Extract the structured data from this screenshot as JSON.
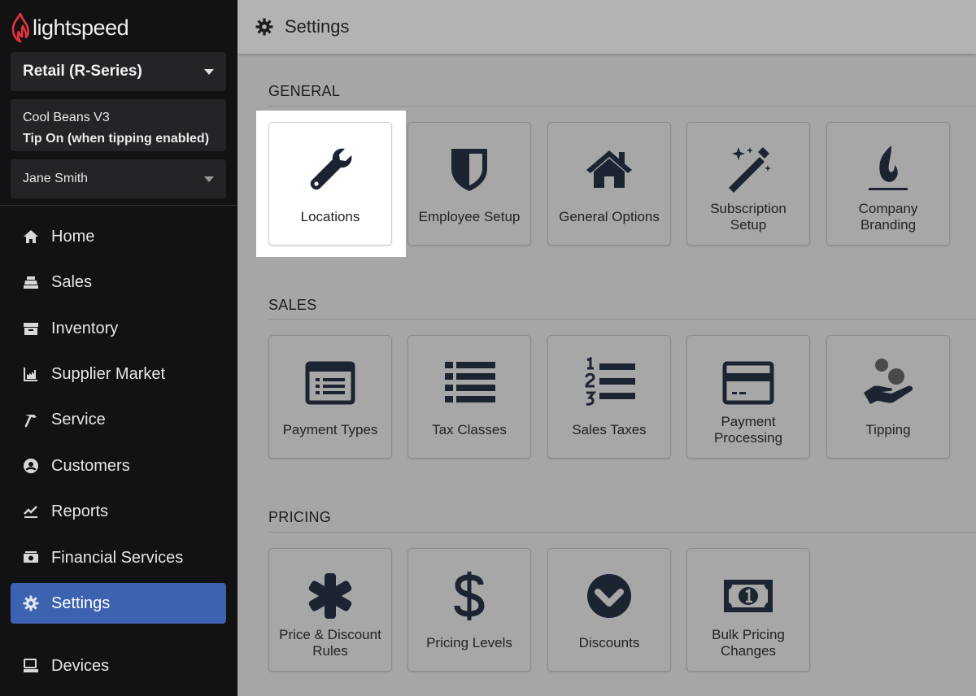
{
  "brand": {
    "name": "lightspeed",
    "logo_icon": "flame-icon",
    "accent": "#e4343f"
  },
  "sidebar": {
    "product": "Retail (R-Series)",
    "location_name": "Cool Beans V3",
    "location_sub": "Tip On (when tipping enabled)",
    "user": "Jane Smith",
    "items": [
      {
        "label": "Home",
        "icon": "home-icon"
      },
      {
        "label": "Sales",
        "icon": "register-icon"
      },
      {
        "label": "Inventory",
        "icon": "archive-icon"
      },
      {
        "label": "Supplier Market",
        "icon": "market-icon"
      },
      {
        "label": "Service",
        "icon": "hammer-icon"
      },
      {
        "label": "Customers",
        "icon": "user-circle-icon"
      },
      {
        "label": "Reports",
        "icon": "chart-line-icon"
      },
      {
        "label": "Financial Services",
        "icon": "money-icon"
      },
      {
        "label": "Settings",
        "icon": "gear-icon",
        "active": true
      },
      {
        "label": "Devices",
        "icon": "monitor-icon"
      }
    ],
    "active_color": "#3c62b0"
  },
  "header": {
    "title": "Settings",
    "icon": "gear-icon"
  },
  "sections": {
    "general": {
      "label": "GENERAL",
      "tiles": [
        {
          "label": "Locations",
          "icon": "wrench-icon"
        },
        {
          "label": "Employee Setup",
          "icon": "shield-icon"
        },
        {
          "label": "General Options",
          "icon": "house-icon"
        },
        {
          "label": "Subscription Setup",
          "icon": "magic-wand-icon"
        },
        {
          "label": "Company Branding",
          "icon": "flame-icon"
        }
      ]
    },
    "sales": {
      "label": "SALES",
      "tiles": [
        {
          "label": "Payment Types",
          "icon": "list-card-icon"
        },
        {
          "label": "Tax Classes",
          "icon": "list-icon"
        },
        {
          "label": "Sales Taxes",
          "icon": "numbered-list-icon"
        },
        {
          "label": "Payment Processing",
          "icon": "credit-card-icon"
        },
        {
          "label": "Tipping",
          "icon": "hand-coins-icon"
        }
      ]
    },
    "pricing": {
      "label": "PRICING",
      "tiles": [
        {
          "label": "Price & Discount Rules",
          "icon": "asterisk-icon"
        },
        {
          "label": "Pricing Levels",
          "icon": "dollar-icon"
        },
        {
          "label": "Discounts",
          "icon": "chevron-circle-down-icon"
        },
        {
          "label": "Bulk Pricing Changes",
          "icon": "money-bill-icon"
        }
      ]
    }
  }
}
